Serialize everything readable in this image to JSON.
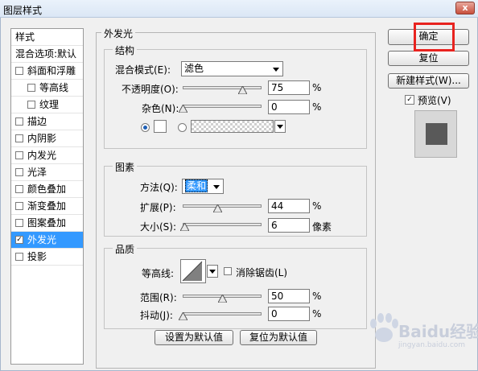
{
  "window": {
    "title": "图层样式",
    "close_glyph": "x"
  },
  "style_list": {
    "header_styles": "样式",
    "header_blending": "混合选项:默认",
    "items": [
      {
        "label": "斜面和浮雕",
        "checked": false
      },
      {
        "label": "等高线",
        "checked": false
      },
      {
        "label": "纹理",
        "checked": false
      },
      {
        "label": "描边",
        "checked": false
      },
      {
        "label": "内阴影",
        "checked": false
      },
      {
        "label": "内发光",
        "checked": false
      },
      {
        "label": "光泽",
        "checked": false
      },
      {
        "label": "颜色叠加",
        "checked": false
      },
      {
        "label": "渐变叠加",
        "checked": false
      },
      {
        "label": "图案叠加",
        "checked": false
      },
      {
        "label": "外发光",
        "checked": true,
        "selected": true
      },
      {
        "label": "投影",
        "checked": false
      }
    ],
    "check_glyph": "✓"
  },
  "panel": {
    "title": "外发光",
    "structure": {
      "title": "结构",
      "blend_mode_label": "混合模式(E):",
      "blend_mode_value": "滤色",
      "opacity_label": "不透明度(O):",
      "opacity_value": "75",
      "opacity_unit": "%",
      "opacity_level": 0.75,
      "noise_label": "杂色(N):",
      "noise_value": "0",
      "noise_unit": "%",
      "noise_level": 0
    },
    "elements": {
      "title": "图素",
      "technique_label": "方法(Q):",
      "technique_value": "柔和",
      "spread_label": "扩展(P):",
      "spread_value": "44",
      "spread_unit": "%",
      "spread_level": 0.44,
      "size_label": "大小(S):",
      "size_value": "6",
      "size_unit": "像素",
      "size_level": 0.02
    },
    "quality": {
      "title": "品质",
      "contour_label": "等高线:",
      "antialias_label": "消除锯齿(L)",
      "antialias_checked": false,
      "range_label": "范围(R):",
      "range_value": "50",
      "range_unit": "%",
      "range_level": 0.5,
      "jitter_label": "抖动(J):",
      "jitter_value": "0",
      "jitter_unit": "%",
      "jitter_level": 0
    },
    "set_default_label": "设置为默认值",
    "reset_default_label": "复位为默认值"
  },
  "actions": {
    "ok_label": "确定",
    "reset_label": "复位",
    "new_style_label": "新建样式(W)...",
    "preview_label": "预览(V)",
    "preview_checked": true
  },
  "watermark": {
    "text": "Baidu经验",
    "sub": "jingyan.baidu.com"
  },
  "colors": {
    "highlight": "#e8231f",
    "selection": "#3399ff",
    "preview_swatch": "#595959"
  }
}
